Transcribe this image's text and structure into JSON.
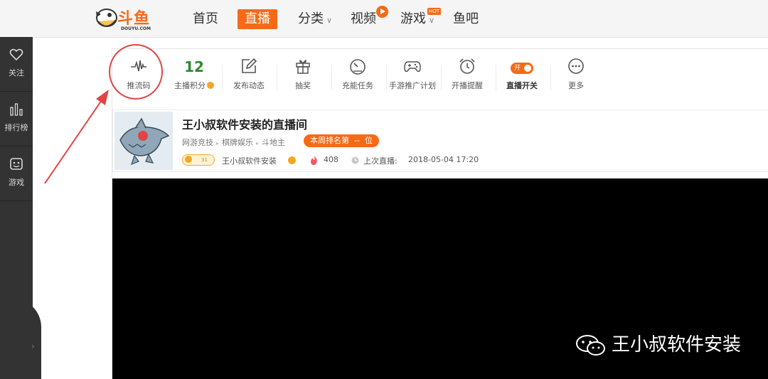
{
  "header": {
    "logo_text": "斗鱼",
    "logo_sub": "DOUYU.COM",
    "nav": [
      {
        "label": "首页"
      },
      {
        "label": "直播",
        "active": true
      },
      {
        "label": "分类"
      },
      {
        "label": "视频"
      },
      {
        "label": "游戏",
        "badge": "HOT"
      },
      {
        "label": "鱼吧"
      }
    ]
  },
  "sidebar": {
    "items": [
      {
        "label": "关注",
        "icon": "heart-icon"
      },
      {
        "label": "排行榜",
        "icon": "bar-chart-icon"
      },
      {
        "label": "游戏",
        "icon": "game-face-icon"
      }
    ],
    "expand_glyph": "›"
  },
  "toolbar": {
    "items": [
      {
        "label": "推流码",
        "icon": "waveform-icon"
      },
      {
        "label": "主播积分",
        "value": "12"
      },
      {
        "label": "发布动态",
        "icon": "edit-icon"
      },
      {
        "label": "抽奖",
        "icon": "gift-icon"
      },
      {
        "label": "充能任务",
        "icon": "gauge-icon"
      },
      {
        "label": "手游推广计划",
        "icon": "gamepad-icon"
      },
      {
        "label": "开播提醒",
        "icon": "alarm-clock-icon"
      },
      {
        "label": "直播开关",
        "toggle_label": "开",
        "toggle_on": true
      },
      {
        "label": "更多",
        "icon": "more-icon"
      }
    ]
  },
  "room": {
    "title": "王小叔软件安装的直播间",
    "categories": [
      "网游竞技",
      "棋牌娱乐",
      "斗地主"
    ],
    "rank_label": "本周排名第",
    "rank_value": "--",
    "rank_suffix": "位",
    "level": "31",
    "owner": "王小叔软件安装",
    "heat": "408",
    "last_live_label": "上次直播:",
    "last_live_time": "2018-05-04 17:20"
  },
  "watermark": "王小叔软件安装",
  "colors": {
    "accent": "#f66a16",
    "score_green": "#2e8b2e",
    "annotation_red": "#e04545"
  }
}
